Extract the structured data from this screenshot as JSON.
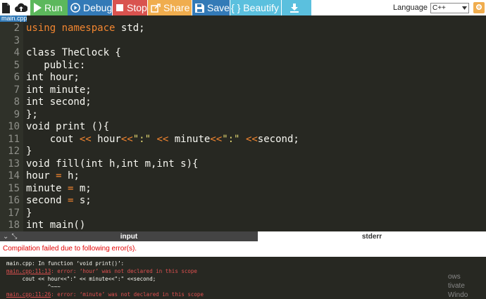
{
  "toolbar": {
    "run_label": "Run",
    "debug_label": "Debug",
    "stop_label": "Stop",
    "share_label": "Share",
    "save_label": "Save",
    "beautify_label": "{ } Beautify",
    "language_label": "Language",
    "language_value": "C++"
  },
  "file_tab": "main.cpp",
  "editor": {
    "lines": [
      {
        "n": "2",
        "text": "using namespace std;"
      },
      {
        "n": "3",
        "text": ""
      },
      {
        "n": "4",
        "text": "class TheClock {"
      },
      {
        "n": "5",
        "text": "   public:"
      },
      {
        "n": "6",
        "text": "int hour;"
      },
      {
        "n": "7",
        "text": "int minute;"
      },
      {
        "n": "8",
        "text": "int second;"
      },
      {
        "n": "9",
        "text": "};"
      },
      {
        "n": "10",
        "text": "void print (){"
      },
      {
        "n": "11",
        "text": "    cout << hour<<\":\" << minute<<\":\" <<second;"
      },
      {
        "n": "12",
        "text": "}"
      },
      {
        "n": "13",
        "text": "void fill(int h,int m,int s){"
      },
      {
        "n": "14",
        "text": "hour = h;"
      },
      {
        "n": "15",
        "text": "minute = m;"
      },
      {
        "n": "16",
        "text": "second = s;"
      },
      {
        "n": "17",
        "text": "}"
      },
      {
        "n": "18",
        "text": "int main()"
      }
    ]
  },
  "panels": {
    "input_tab": "input",
    "stderr_tab": "stderr"
  },
  "status": "Compilation failed due to following error(s).",
  "output": {
    "line1": "main.cpp: In function ‘void print()’:",
    "err1_loc": "main.cpp:11:13",
    "err1_msg": ": error: ‘hour’ was not declared in this scope",
    "line3": "     cout << hour<<\":\" << minute<<\":\" <<second;",
    "line4": "             ^~~~",
    "err2_loc": "main.cpp:11:26",
    "err2_msg": ": error: ‘minute’ was not declared in this scope"
  },
  "watermark": {
    "line1": "ows",
    "line2": "tivate Windo"
  },
  "colors": {
    "run": "#5cb85c",
    "debug": "#337ab7",
    "stop": "#d9534f",
    "share": "#f0ad4e",
    "save": "#337ab7",
    "beautify": "#5bc0de",
    "editor_bg": "#272822",
    "keyword": "#f38630",
    "string": "#e6db74",
    "error": "#e30000"
  },
  "icons": {
    "file": "file-icon",
    "upload": "upload-icon",
    "run": "play-icon",
    "debug": "debug-icon",
    "stop": "stop-icon",
    "share": "share-icon",
    "save": "save-icon",
    "download": "download-icon",
    "settings": "settings-icon"
  }
}
